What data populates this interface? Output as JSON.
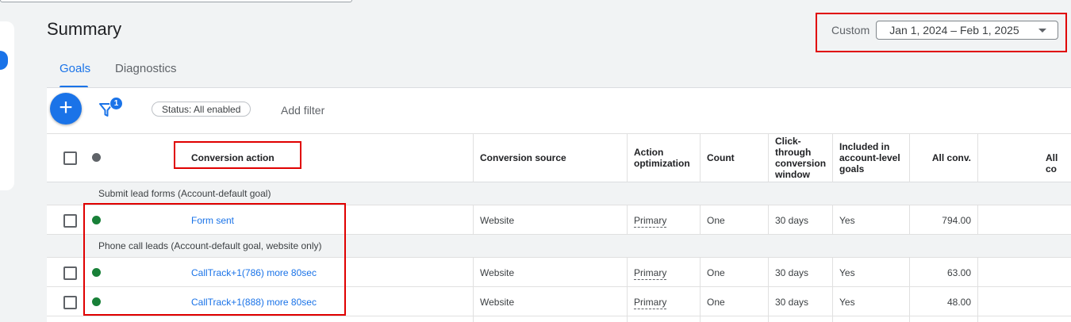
{
  "page": {
    "title": "Summary"
  },
  "date_range": {
    "label": "Custom",
    "value": "Jan 1, 2024 – Feb 1, 2025"
  },
  "tabs": [
    {
      "label": "Goals",
      "active": true
    },
    {
      "label": "Diagnostics",
      "active": false
    }
  ],
  "toolbar": {
    "filter_badge_count": "1",
    "status_chip": "Status: All enabled",
    "add_filter": "Add filter"
  },
  "table": {
    "columns": {
      "conversion_action": "Conversion action",
      "conversion_source": "Conversion source",
      "action_optimization": "Action optimization",
      "count": "Count",
      "click_through": "Click-through conversion window",
      "included": "Included in account-level goals",
      "all_conv": "All conv.",
      "all_conv_value": "All co"
    },
    "groups": [
      {
        "label": "Submit lead forms (Account-default goal)",
        "rows": [
          {
            "action": "Form sent",
            "source": "Website",
            "optimization": "Primary",
            "count": "One",
            "window": "30 days",
            "included": "Yes",
            "all_conv": "794.00"
          }
        ]
      },
      {
        "label": "Phone call leads (Account-default goal, website only)",
        "rows": [
          {
            "action": "CallTrack+1(786) more 80sec",
            "source": "Website",
            "optimization": "Primary",
            "count": "One",
            "window": "30 days",
            "included": "Yes",
            "all_conv": "63.00"
          },
          {
            "action": "CallTrack+1(888) more 80sec",
            "source": "Website",
            "optimization": "Primary",
            "count": "One",
            "window": "30 days",
            "included": "Yes",
            "all_conv": "48.00"
          }
        ]
      }
    ]
  },
  "colors": {
    "accent": "#1a73e8",
    "status_enabled": "#188038",
    "highlight": "#e00000"
  }
}
